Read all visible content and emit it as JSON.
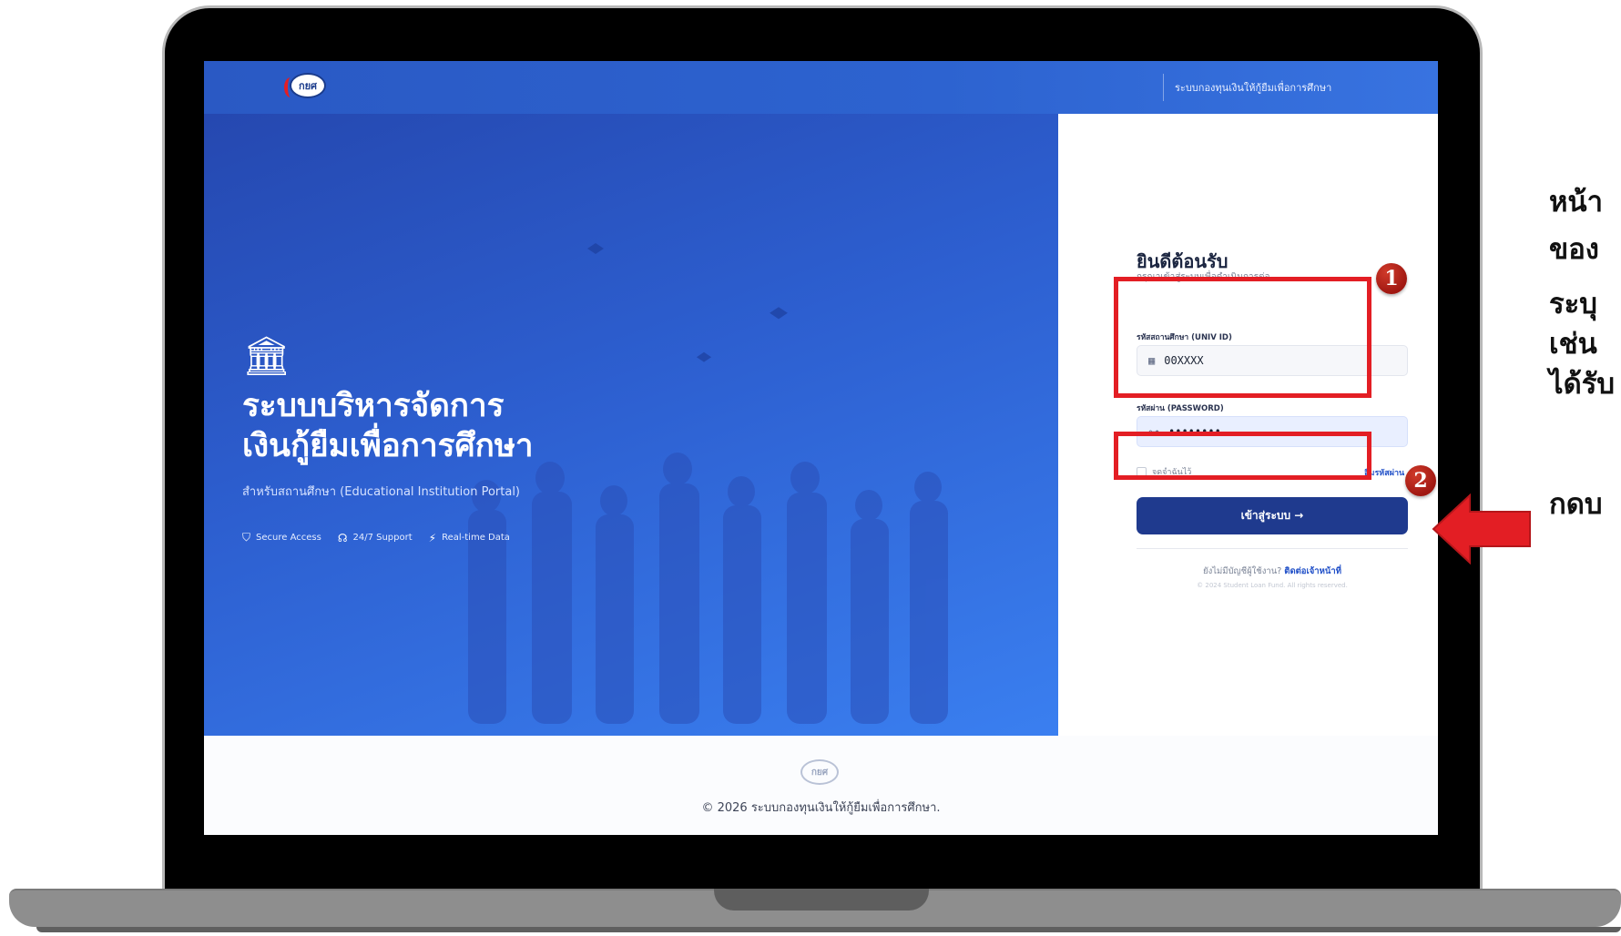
{
  "topbar": {
    "logo_text": "กยศ",
    "title": "ระบบกองทุนเงินให้กู้ยืมเพื่อการศึกษา"
  },
  "hero": {
    "icon": "🏛",
    "title_line1": "ระบบบริหารจัดการ",
    "title_line2": "เงินกู้ยืมเพื่อการศึกษา",
    "subtitle": "สำหรับสถานศึกษา (Educational Institution Portal)",
    "features": [
      {
        "icon": "shield-icon",
        "label": "Secure Access"
      },
      {
        "icon": "headset-icon",
        "label": "24/7 Support"
      },
      {
        "icon": "lightning-icon",
        "label": "Real-time Data"
      }
    ]
  },
  "login": {
    "welcome": "ยินดีต้อนรับ",
    "welcome_sub": "กรุณาเข้าสู่ระบบเพื่อดำเนินการต่อ",
    "univ_label": "รหัสสถานศึกษา (UNIV ID)",
    "univ_value": "00XXXX",
    "password_label": "รหัสผ่าน (PASSWORD)",
    "password_value": "••••••••",
    "remember_label": "จดจำฉันไว้",
    "forgot_label": "ลืมรหัสผ่าน",
    "login_button": "เข้าสู่ระบบ →",
    "no_account": "ยังไม่มีบัญชีผู้ใช้งาน?",
    "contact": "ติดต่อเจ้าหน้าที่",
    "copyright_small": "© 2024 Student Loan Fund. All rights reserved."
  },
  "footer": {
    "logo_text": "กยศ",
    "copyright": "© 2026 ระบบกองทุนเงินให้กู้ยืมเพื่อการศึกษา."
  },
  "annotations": {
    "badge1": "1",
    "badge2": "2",
    "side_lines": [
      "หน้า",
      "ของ",
      "ระบุ",
      "เช่น",
      "ได้รับ",
      "กดบ"
    ]
  },
  "colors": {
    "accent": "#e31e24",
    "topbar": "#2d63d0",
    "button": "#1f3a8e",
    "link": "#2251c8"
  }
}
